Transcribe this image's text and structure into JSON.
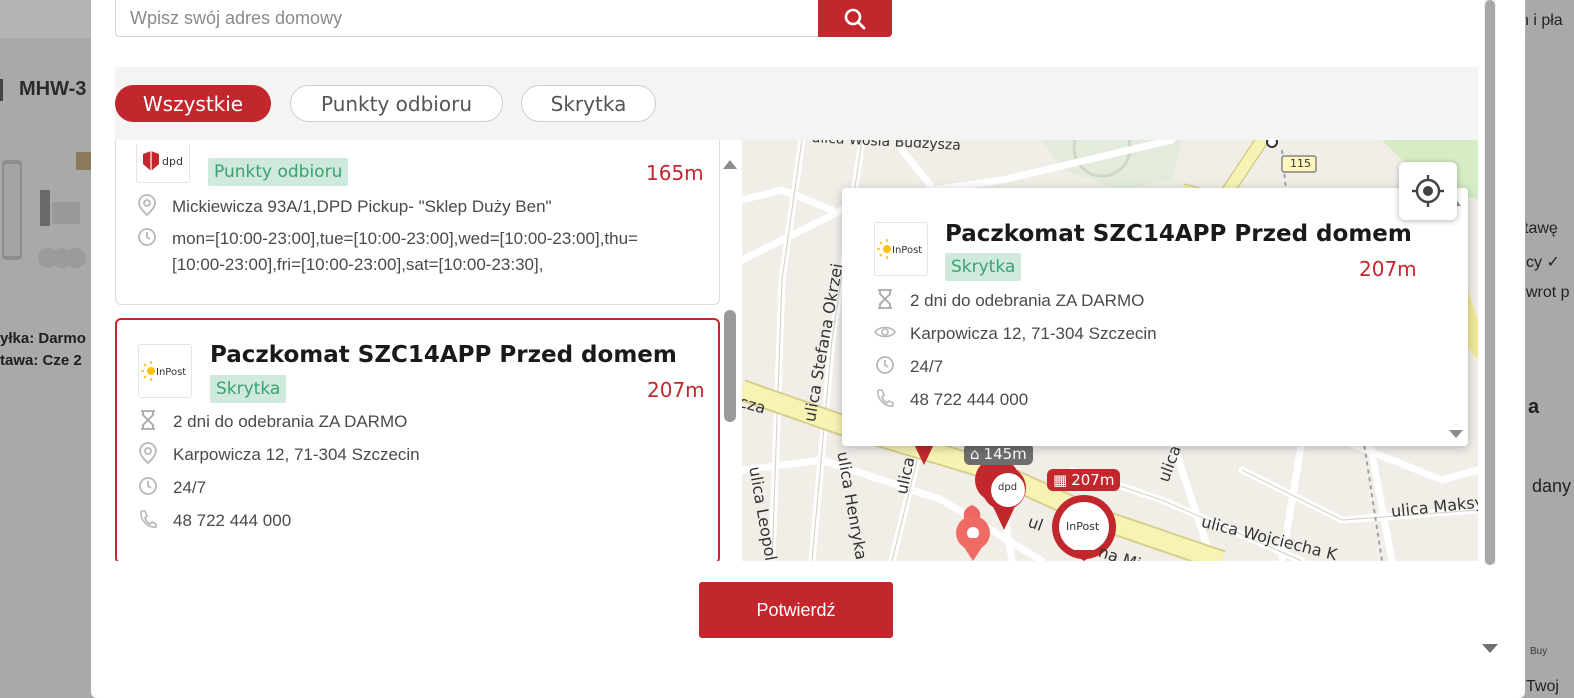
{
  "background": {
    "product_title": "MHW-3",
    "shipping_line1": "yłka: Darmo",
    "shipping_line2": "tawa: Cze 2",
    "right_texts": [
      "n i pła",
      "tawę",
      "cy ✓",
      "wrot p",
      "a",
      "dany",
      "Buy",
      "Twoj"
    ]
  },
  "search": {
    "placeholder": "Wpisz swój adres domowy"
  },
  "filters": {
    "items": [
      {
        "label": "Wszystkie",
        "active": true
      },
      {
        "label": "Punkty odbioru",
        "active": false
      },
      {
        "label": "Skrytka",
        "active": false
      }
    ]
  },
  "list": {
    "cards": [
      {
        "logo": "DPD",
        "badge": "Punkty odbioru",
        "distance": "165m",
        "address": "Mickiewicza 93A/1,DPD Pickup- \"Sklep Duży Ben\"",
        "hours_line1": "mon=[10:00-23:00],tue=[10:00-23:00],wed=[10:00-23:00],thu=",
        "hours_line2": "[10:00-23:00],fri=[10:00-23:00],sat=[10:00-23:30],"
      },
      {
        "logo": "InPost",
        "title": "Paczkomat SZC14APP Przed domem",
        "badge": "Skrytka",
        "distance": "207m",
        "pickup": "2 dni do odebrania ZA DARMO",
        "address": "Karpowicza 12, 71-304 Szczecin",
        "hours": "24/7",
        "phone": "48 722 444 000"
      }
    ]
  },
  "map": {
    "street_labels": [
      "ulica Wosia Budzysza",
      "ulica Stefana Okrzei",
      "ulica Henryka W",
      "ulica Leopold",
      "ulica Wojciecha K",
      "ulica Maksym",
      "ulica",
      "ulica",
      "cza",
      "ul",
      "na Mi"
    ],
    "road_number": "115",
    "marker_labels": [
      "145m",
      "207m"
    ],
    "marker_logos": [
      "dpd",
      "InPost"
    ],
    "popup": {
      "logo": "InPost",
      "title": "Paczkomat SZC14APP Przed domem",
      "badge": "Skrytka",
      "distance": "207m",
      "pickup": "2 dni do odebrania ZA DARMO",
      "address": "Karpowicza 12, 71-304 Szczecin",
      "hours": "24/7",
      "phone": "48 722 444 000"
    }
  },
  "confirm_label": "Potwierdź",
  "colors": {
    "accent": "#c1272d",
    "badge_bg": "#cfe9dc",
    "badge_text": "#3aa273"
  }
}
